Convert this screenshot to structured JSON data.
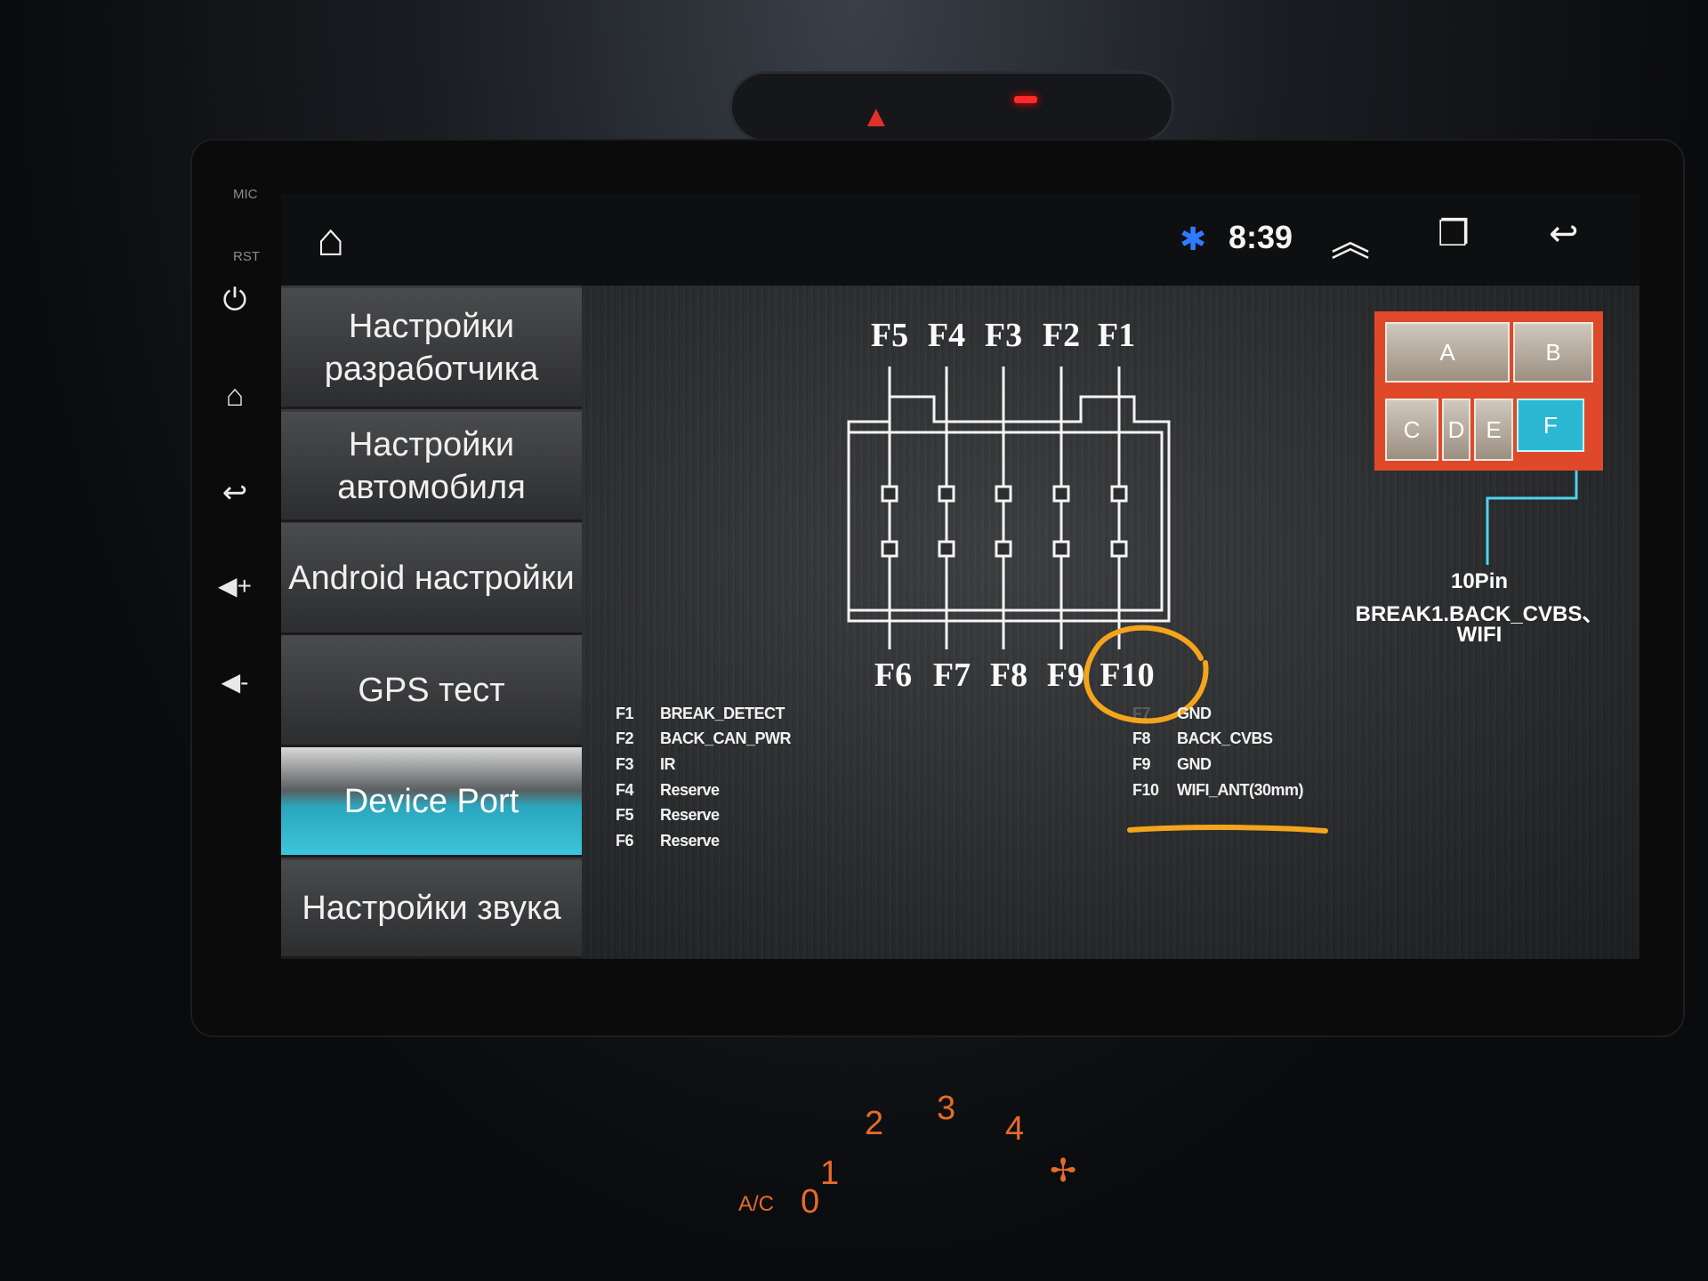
{
  "bezel": {
    "mic_label": "MIC",
    "rst_label": "RST",
    "buttons": [
      "power-icon",
      "home-icon",
      "back-icon",
      "volume-up-icon",
      "volume-down-icon"
    ]
  },
  "statusbar": {
    "time": "8:39",
    "icons": [
      "home-icon",
      "bluetooth-icon",
      "chevron-up-icon",
      "recent-apps-icon",
      "back-icon"
    ],
    "bluetooth_color": "#2f7bff"
  },
  "sidebar": {
    "items": [
      {
        "label": "Настройки разработчика",
        "active": false
      },
      {
        "label": "Настройки автомобиля",
        "active": false
      },
      {
        "label": "Android настройки",
        "active": false
      },
      {
        "label": "GPS тест",
        "active": false
      },
      {
        "label": "Device Port",
        "active": true
      },
      {
        "label": "Настройки звука",
        "active": false
      }
    ],
    "accent": "#2cb8d2"
  },
  "diagram": {
    "top_pins": [
      "F5",
      "F4",
      "F3",
      "F2",
      "F1"
    ],
    "bottom_pins": [
      "F6",
      "F7",
      "F8",
      "F9",
      "F10"
    ],
    "pins_left": [
      {
        "pin": "F1",
        "signal": "BREAK_DETECT"
      },
      {
        "pin": "F2",
        "signal": "BACK_CAN_PWR"
      },
      {
        "pin": "F3",
        "signal": "IR"
      },
      {
        "pin": "F4",
        "signal": "Reserve"
      },
      {
        "pin": "F5",
        "signal": "Reserve"
      },
      {
        "pin": "F6",
        "signal": "Reserve"
      }
    ],
    "pins_right": [
      {
        "pin": "F7",
        "signal": "GND"
      },
      {
        "pin": "F8",
        "signal": "BACK_CVBS"
      },
      {
        "pin": "F9",
        "signal": "GND"
      },
      {
        "pin": "F10",
        "signal": "WIFI_ANT(30mm)"
      }
    ]
  },
  "connector": {
    "slots": [
      "A",
      "B",
      "C",
      "D",
      "E",
      "F"
    ],
    "selected": "F",
    "line1": "10Pin",
    "line2": "BREAK1.BACK_CVBS、",
    "line3": "WIFI",
    "frame_color": "#e0482a"
  },
  "annotation_color": "#f4a51c",
  "dashboard": {
    "fan_speeds": [
      "0",
      "1",
      "2",
      "3",
      "4"
    ],
    "ac_label": "A/C"
  }
}
